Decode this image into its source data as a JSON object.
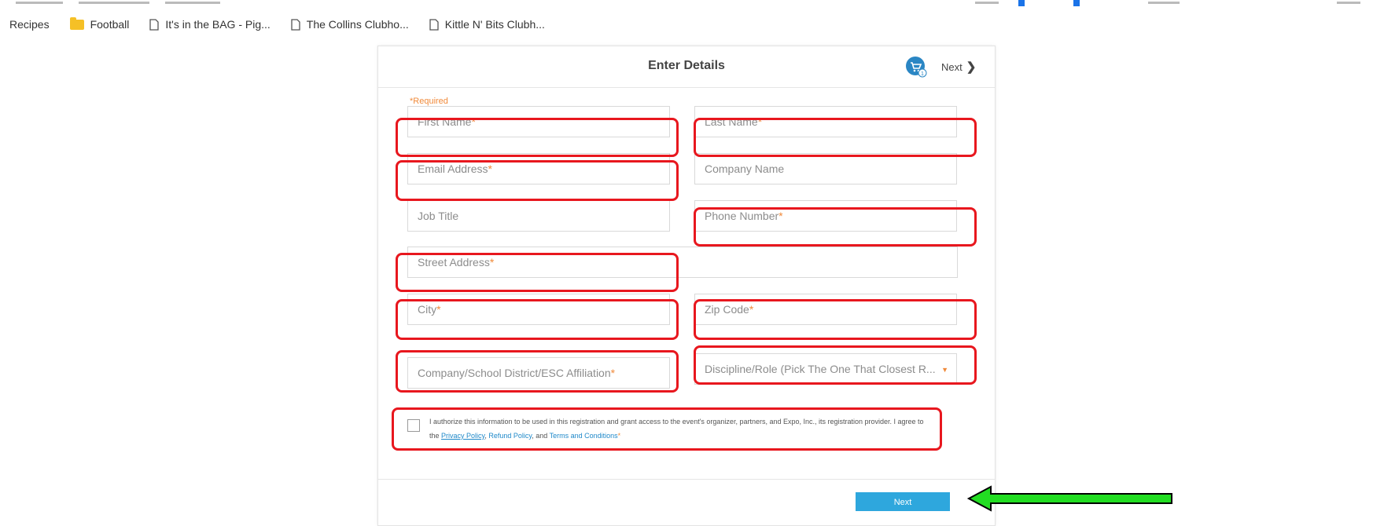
{
  "browser": {
    "bookmarks": [
      {
        "label": "Recipes",
        "icon": "none"
      },
      {
        "label": "Football",
        "icon": "folder-icon"
      },
      {
        "label": "It's in the BAG - Pig...",
        "icon": "page-icon"
      },
      {
        "label": "The Collins Clubho...",
        "icon": "page-icon"
      },
      {
        "label": "Kittle N' Bits Clubh...",
        "icon": "page-icon"
      }
    ]
  },
  "header": {
    "title": "Enter Details",
    "cart_count": "1",
    "next_label": "Next"
  },
  "form": {
    "required_note": "*Required",
    "fields": {
      "first_name": {
        "label": "First Name",
        "star": "*"
      },
      "last_name": {
        "label": "Last Name",
        "star": "*"
      },
      "email": {
        "label": "Email Address",
        "star": "*"
      },
      "company_name": {
        "label": "Company Name"
      },
      "job_title": {
        "label": "Job Title"
      },
      "phone": {
        "label": "Phone Number",
        "star": "*"
      },
      "street": {
        "label": "Street Address",
        "star": "*"
      },
      "city": {
        "label": "City",
        "star": "*"
      },
      "zip": {
        "label": "Zip Code",
        "star": "*"
      },
      "affiliation": {
        "label": "Company/School District/ESC Affiliation",
        "star": "*"
      },
      "discipline": {
        "label": "Discipline/Role (Pick The One That Closest R...",
        "caret": "▼"
      }
    },
    "consent": {
      "text_before": "I authorize this information to be used in this registration and grant access to the event's organizer, partners, and Expo, Inc., its registration provider. I agree to the ",
      "privacy_link": "Privacy Policy",
      "separator": ", ",
      "refund_link": "Refund Policy",
      "and_text": ", and ",
      "terms_link": "Terms and Conditions",
      "star": "*"
    },
    "next_button": "Next"
  },
  "colors": {
    "accent": "#2ea7dd",
    "highlight": "#e8171e",
    "required": "#f08a3a",
    "arrow": "#22dd22"
  }
}
